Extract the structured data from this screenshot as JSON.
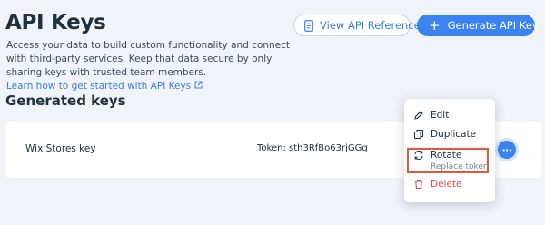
{
  "header": {
    "title": "API Keys",
    "view_reference_label": "View API Reference",
    "generate_label": "Generate API Key"
  },
  "description": {
    "text": "Access your data to build custom functionality and connect with third-party services. Keep that data secure by only sharing keys with trusted team members.",
    "link_text": "Learn how to get started with API Keys"
  },
  "section": {
    "title": "Generated keys"
  },
  "keys": [
    {
      "name": "Wix Stores key",
      "token": "Token: sth3RfBo63rjGGg"
    }
  ],
  "row_actions": {
    "more_label": "···"
  },
  "menu": {
    "edit": "Edit",
    "duplicate": "Duplicate",
    "rotate": "Rotate",
    "rotate_sub": "Replace token",
    "delete": "Delete"
  },
  "colors": {
    "primary": "#3b83f0",
    "link": "#3b7de0",
    "danger": "#e04a4a",
    "highlight_border": "#e3573b",
    "background": "#f0f3f8"
  },
  "icons": [
    "document-icon",
    "plus-icon",
    "external-link-icon",
    "more-icon",
    "pencil-icon",
    "duplicate-icon",
    "rotate-icon",
    "trash-icon"
  ]
}
